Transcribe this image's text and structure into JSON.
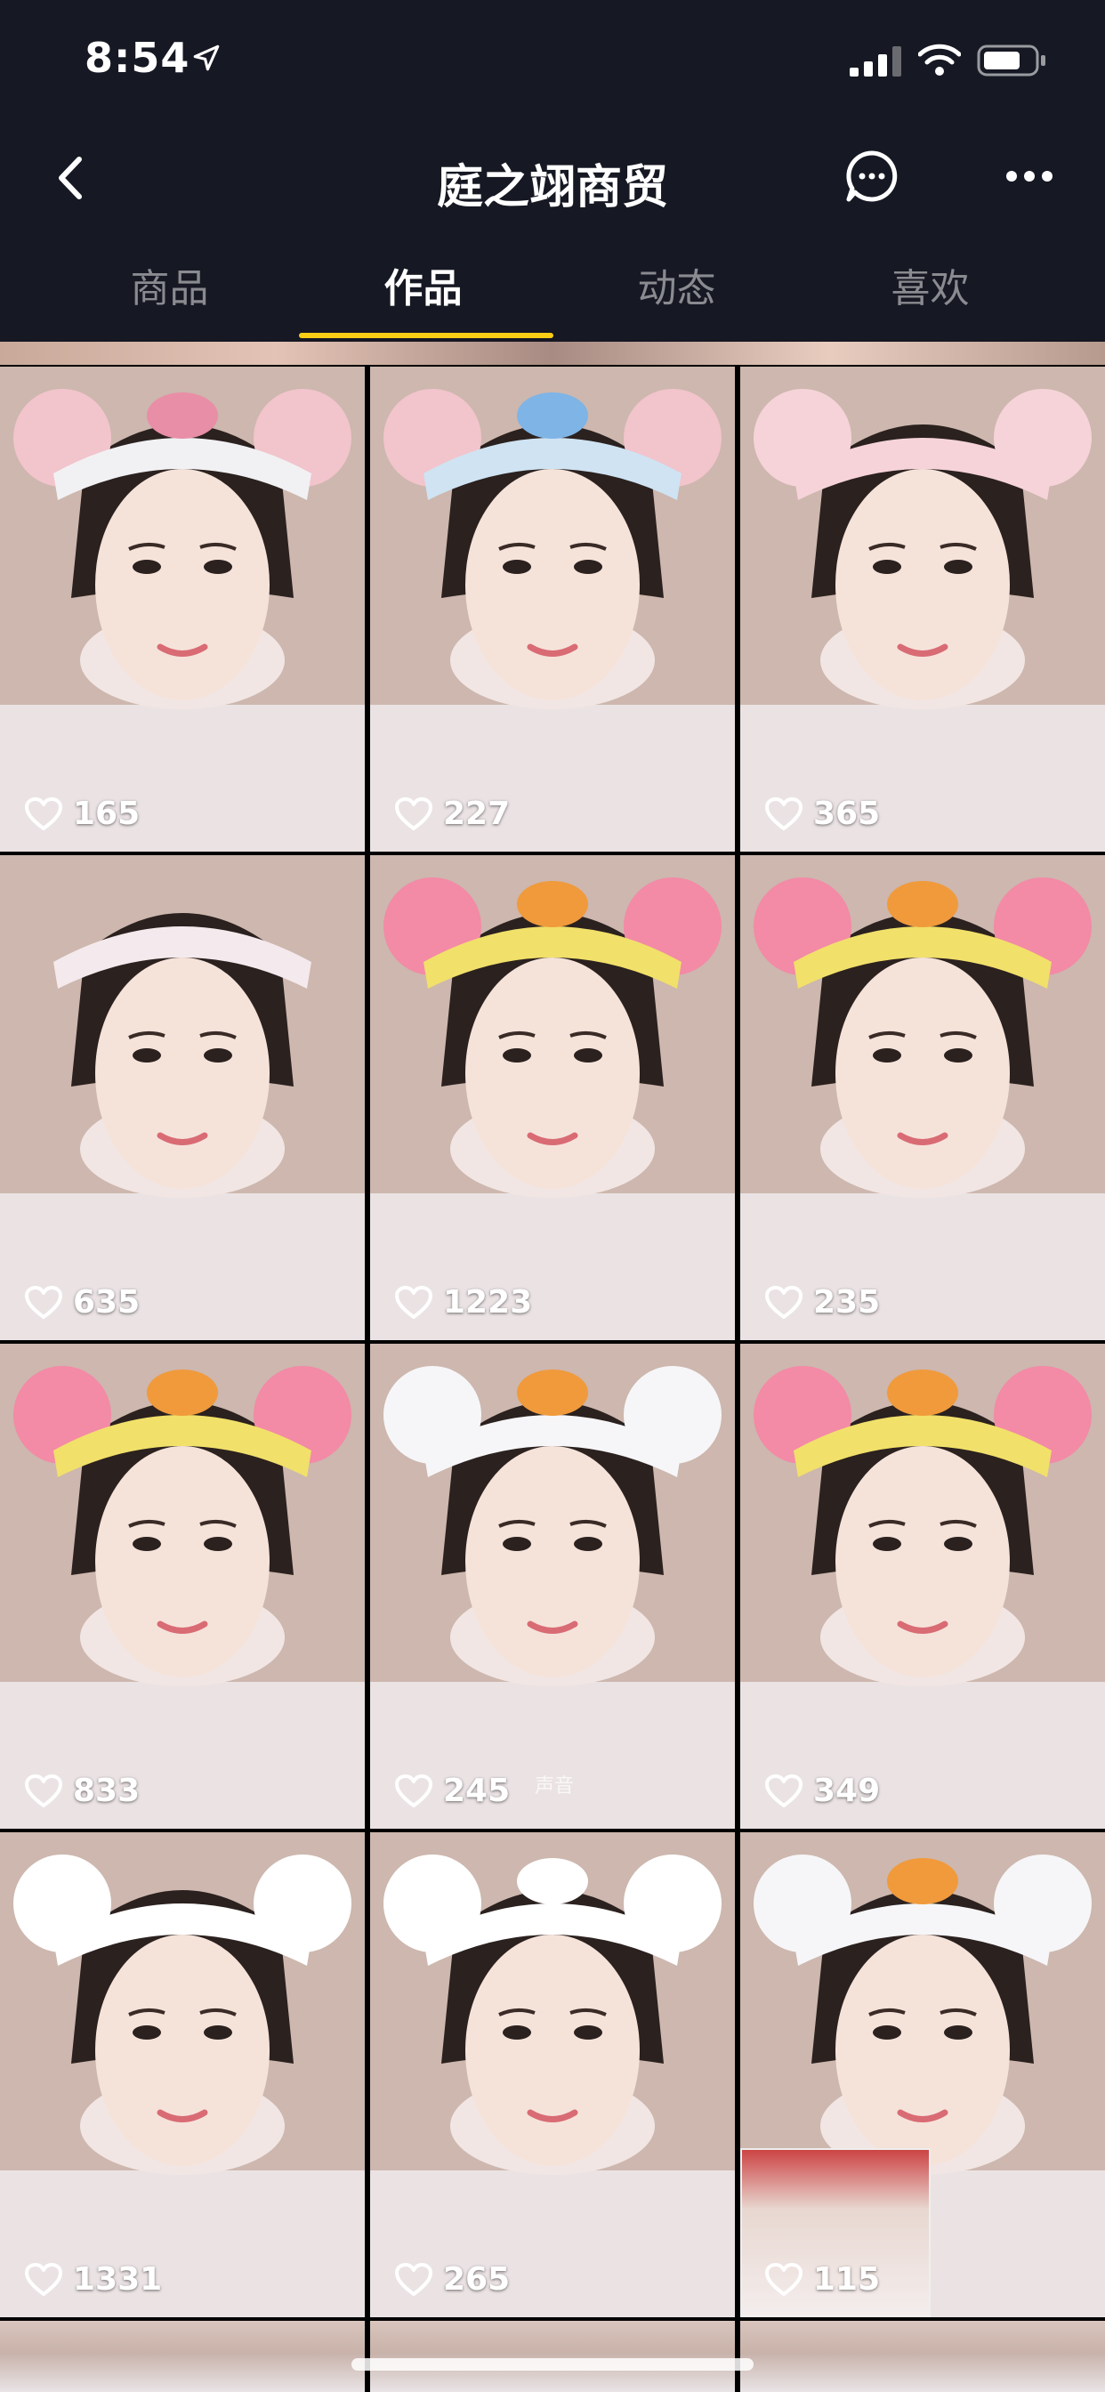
{
  "status_bar": {
    "time": "8:54"
  },
  "nav": {
    "title": "庭之翊商贸"
  },
  "tabs": [
    {
      "label": "商品"
    },
    {
      "label": "作品"
    },
    {
      "label": "动态"
    },
    {
      "label": "喜欢"
    }
  ],
  "active_tab": "作品",
  "grid": {
    "items": [
      {
        "likes": "165",
        "headband": "pink bear ears"
      },
      {
        "likes": "227",
        "headband": "blue flower ears"
      },
      {
        "likes": "365",
        "headband": "pink towel"
      },
      {
        "likes": "635",
        "headband": "sheet mask"
      },
      {
        "likes": "1223",
        "headband": "yellow duck"
      },
      {
        "likes": "235",
        "headband": "yellow duck"
      },
      {
        "likes": "833",
        "headband": "yellow duck"
      },
      {
        "likes": "245",
        "headband": "white bunny",
        "sound_label": "声音"
      },
      {
        "likes": "349",
        "headband": "yellow duck"
      },
      {
        "likes": "1331",
        "headband": "white lace"
      },
      {
        "likes": "265",
        "headband": "white bow"
      },
      {
        "likes": "115",
        "headband": "white bunny"
      }
    ]
  },
  "colors": {
    "background": "#161823",
    "accent": "#face15",
    "tab_inactive": "#8a8b91"
  },
  "icons": [
    "location-arrow-icon",
    "signal-icon",
    "wifi-icon",
    "battery-icon",
    "back-chevron-icon",
    "message-bubble-icon",
    "more-dots-icon",
    "heart-icon"
  ]
}
